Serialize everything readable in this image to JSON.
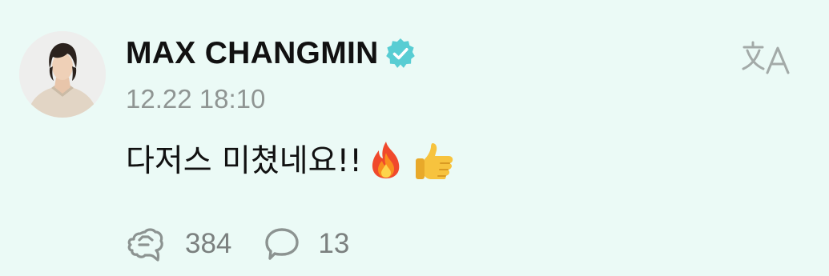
{
  "post": {
    "author": "MAX CHANGMIN",
    "timestamp": "12.22 18:10",
    "text": "다저스 미쳤네요!!",
    "emoji": [
      "fire-emoji",
      "thumbs-up-emoji"
    ],
    "likes": "384",
    "comments": "13"
  },
  "icons": {
    "verified": "verified-badge-icon",
    "translate": "translate-icon",
    "like": "like-icon",
    "comment": "comment-icon"
  },
  "colors": {
    "background": "#ebfaf6",
    "verified_badge": "#58cdd3",
    "muted": "#8f9593"
  }
}
